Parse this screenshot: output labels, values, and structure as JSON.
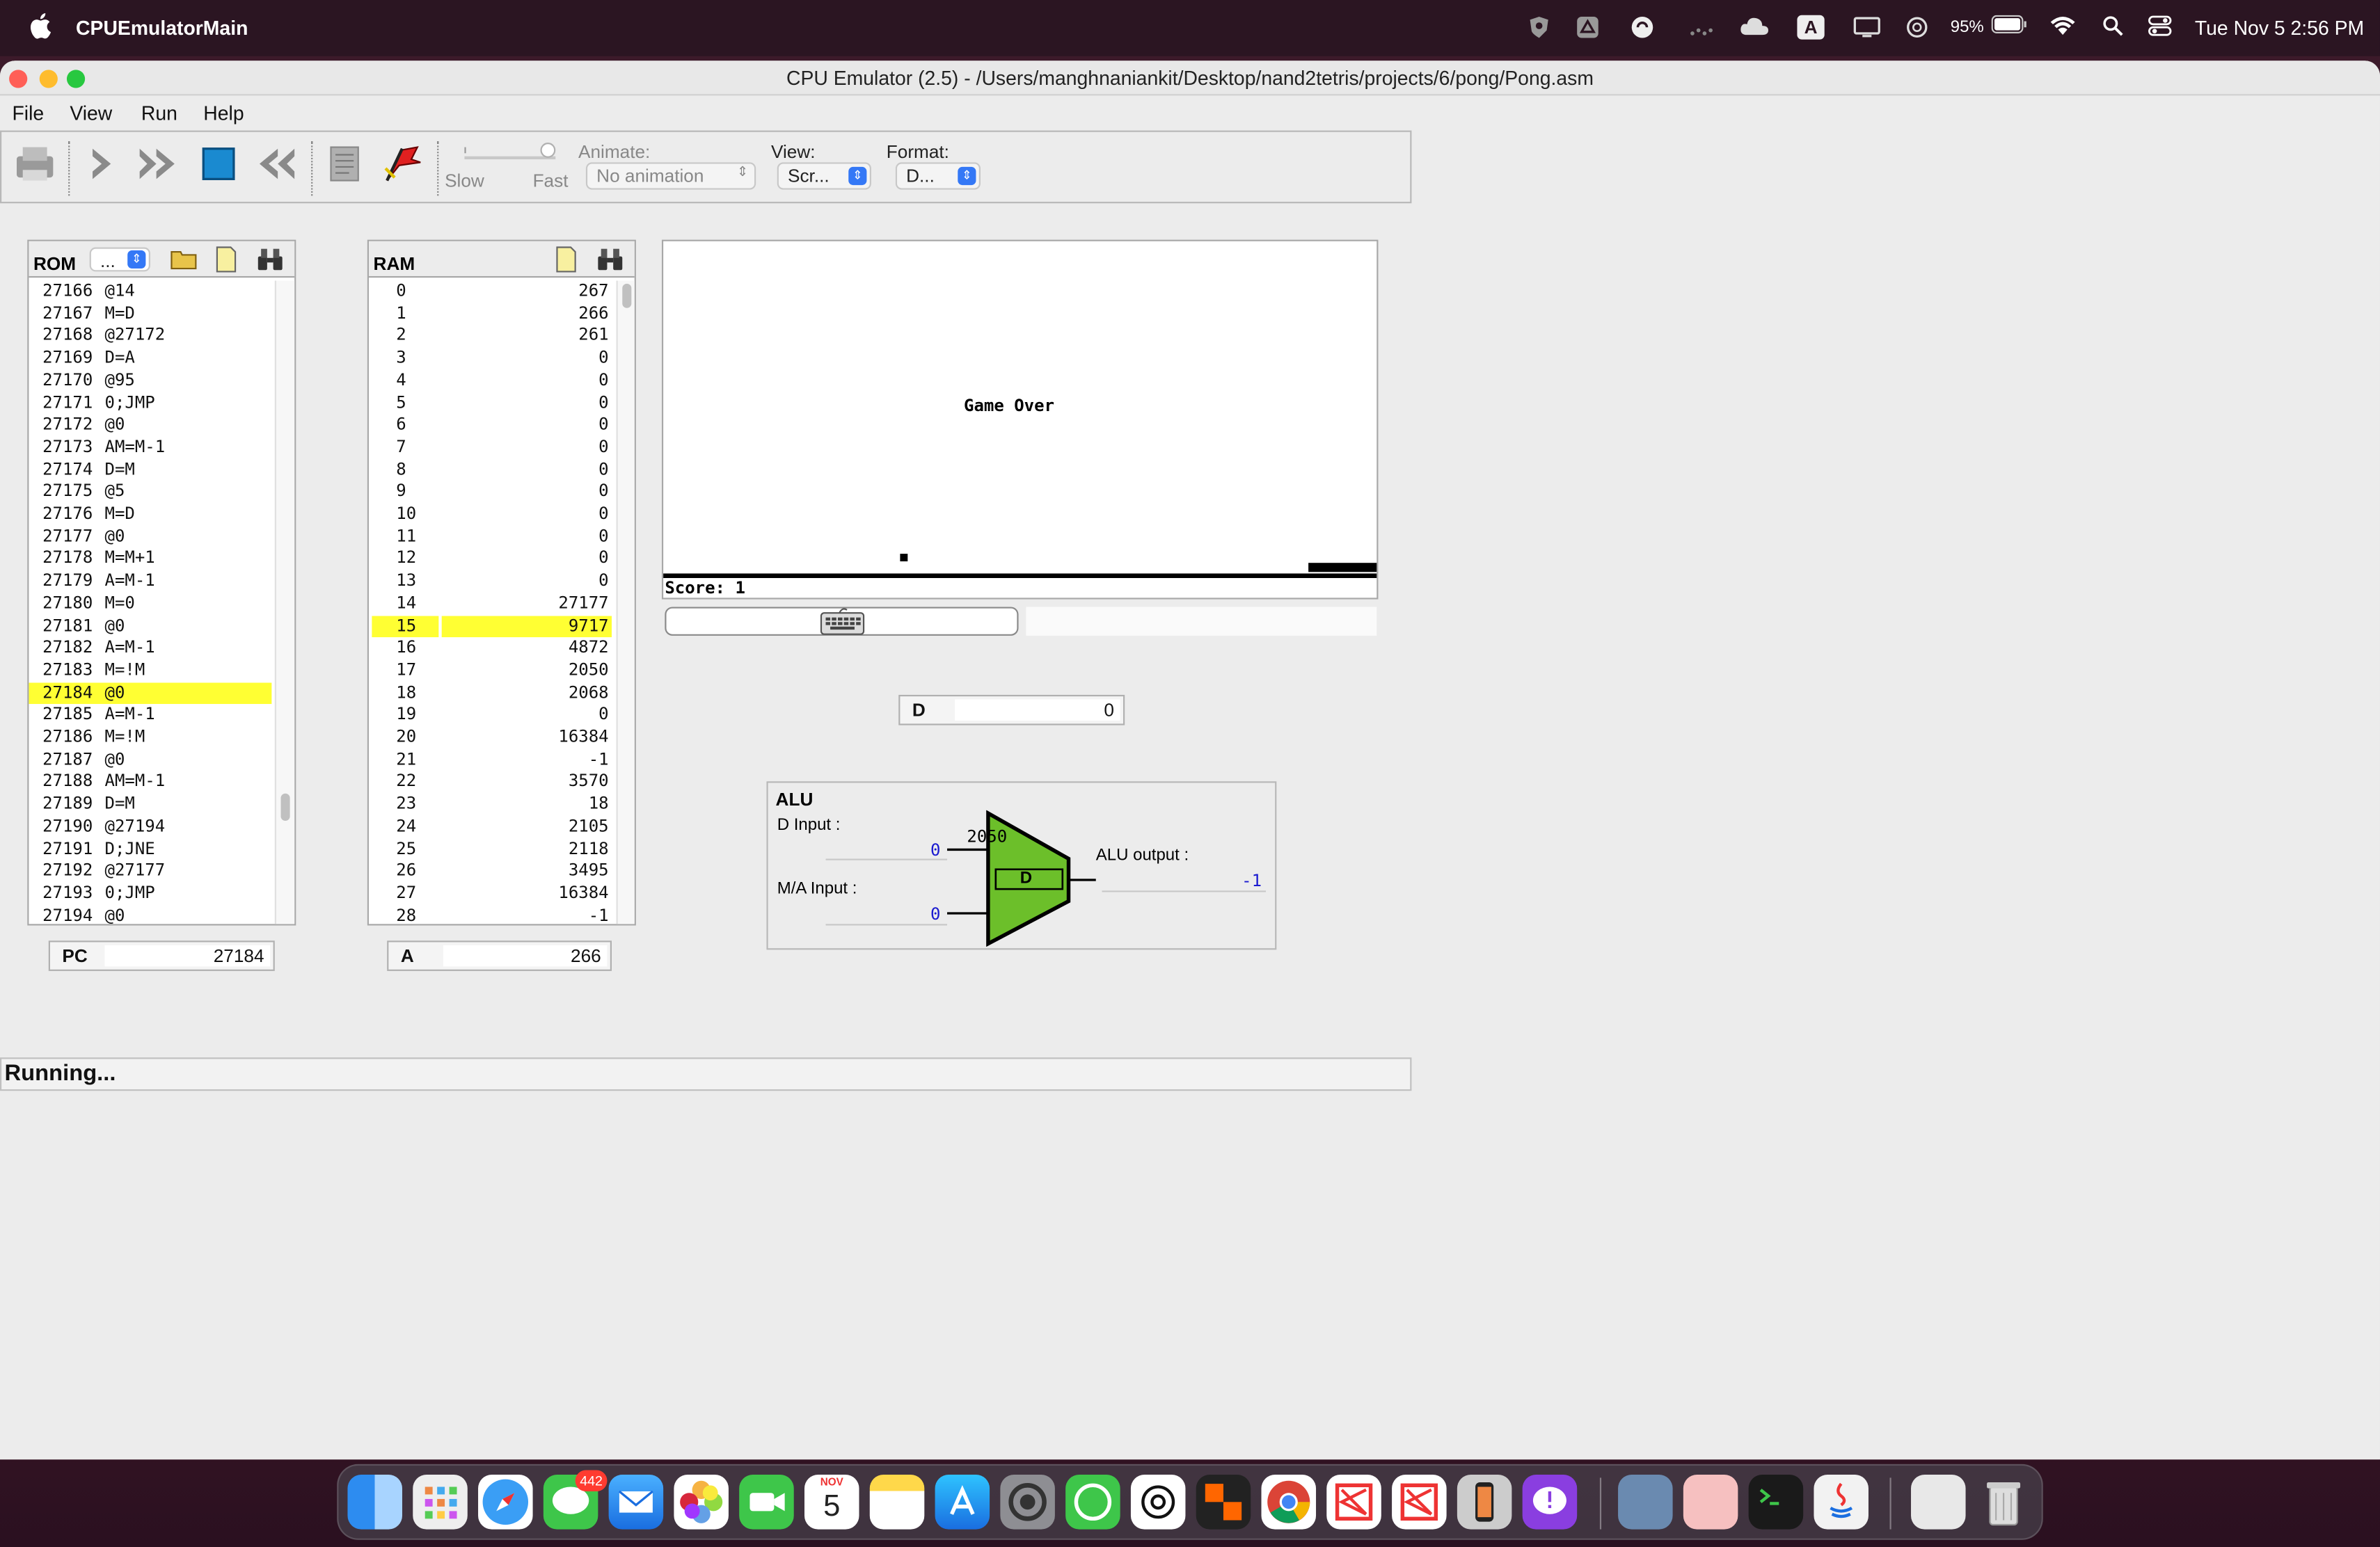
{
  "menubar": {
    "app_name": "CPUEmulatorMain",
    "battery": "95%",
    "clock": "Tue Nov 5  2:56 PM",
    "input_letter": "A"
  },
  "window": {
    "title": "CPU Emulator (2.5) - /Users/manghnaniankit/Desktop/nand2tetris/projects/6/pong/Pong.asm"
  },
  "menu": {
    "file": "File",
    "view": "View",
    "run": "Run",
    "help": "Help"
  },
  "toolbar": {
    "slow": "Slow",
    "fast": "Fast",
    "animate_label": "Animate:",
    "animate_value": "No animation",
    "view_label": "View:",
    "view_value": "Scr...",
    "format_label": "Format:",
    "format_value": "D..."
  },
  "rom": {
    "title": "ROM",
    "combo_value": "...",
    "rows": [
      {
        "addr": "27166",
        "instr": "@14"
      },
      {
        "addr": "27167",
        "instr": "M=D"
      },
      {
        "addr": "27168",
        "instr": "@27172"
      },
      {
        "addr": "27169",
        "instr": "D=A"
      },
      {
        "addr": "27170",
        "instr": "@95"
      },
      {
        "addr": "27171",
        "instr": "0;JMP"
      },
      {
        "addr": "27172",
        "instr": "@0"
      },
      {
        "addr": "27173",
        "instr": "AM=M-1"
      },
      {
        "addr": "27174",
        "instr": "D=M"
      },
      {
        "addr": "27175",
        "instr": "@5"
      },
      {
        "addr": "27176",
        "instr": "M=D"
      },
      {
        "addr": "27177",
        "instr": "@0"
      },
      {
        "addr": "27178",
        "instr": "M=M+1"
      },
      {
        "addr": "27179",
        "instr": "A=M-1"
      },
      {
        "addr": "27180",
        "instr": "M=0"
      },
      {
        "addr": "27181",
        "instr": "@0"
      },
      {
        "addr": "27182",
        "instr": "A=M-1"
      },
      {
        "addr": "27183",
        "instr": "M=!M"
      },
      {
        "addr": "27184",
        "instr": "@0"
      },
      {
        "addr": "27185",
        "instr": "A=M-1"
      },
      {
        "addr": "27186",
        "instr": "M=!M"
      },
      {
        "addr": "27187",
        "instr": "@0"
      },
      {
        "addr": "27188",
        "instr": "AM=M-1"
      },
      {
        "addr": "27189",
        "instr": "D=M"
      },
      {
        "addr": "27190",
        "instr": "@27194"
      },
      {
        "addr": "27191",
        "instr": "D;JNE"
      },
      {
        "addr": "27192",
        "instr": "@27177"
      },
      {
        "addr": "27193",
        "instr": "0;JMP"
      },
      {
        "addr": "27194",
        "instr": "@0"
      }
    ],
    "highlight_index": 18
  },
  "ram": {
    "title": "RAM",
    "rows": [
      {
        "addr": "0",
        "val": "267"
      },
      {
        "addr": "1",
        "val": "266"
      },
      {
        "addr": "2",
        "val": "261"
      },
      {
        "addr": "3",
        "val": "0"
      },
      {
        "addr": "4",
        "val": "0"
      },
      {
        "addr": "5",
        "val": "0"
      },
      {
        "addr": "6",
        "val": "0"
      },
      {
        "addr": "7",
        "val": "0"
      },
      {
        "addr": "8",
        "val": "0"
      },
      {
        "addr": "9",
        "val": "0"
      },
      {
        "addr": "10",
        "val": "0"
      },
      {
        "addr": "11",
        "val": "0"
      },
      {
        "addr": "12",
        "val": "0"
      },
      {
        "addr": "13",
        "val": "0"
      },
      {
        "addr": "14",
        "val": "27177"
      },
      {
        "addr": "15",
        "val": "9717"
      },
      {
        "addr": "16",
        "val": "4872"
      },
      {
        "addr": "17",
        "val": "2050"
      },
      {
        "addr": "18",
        "val": "2068"
      },
      {
        "addr": "19",
        "val": "0"
      },
      {
        "addr": "20",
        "val": "16384"
      },
      {
        "addr": "21",
        "val": "-1"
      },
      {
        "addr": "22",
        "val": "3570"
      },
      {
        "addr": "23",
        "val": "18"
      },
      {
        "addr": "24",
        "val": "2105"
      },
      {
        "addr": "25",
        "val": "2118"
      },
      {
        "addr": "26",
        "val": "3495"
      },
      {
        "addr": "27",
        "val": "16384"
      },
      {
        "addr": "28",
        "val": "-1"
      }
    ],
    "highlight_index": 15
  },
  "registers": {
    "pc_label": "PC",
    "pc_value": "27184",
    "a_label": "A",
    "a_value": "266",
    "d_label": "D",
    "d_value": "0"
  },
  "screen": {
    "game_over": "Game Over",
    "score": "Score: 1"
  },
  "alu": {
    "title": "ALU",
    "d_input_label": "D Input :",
    "d_input_value": "0",
    "ma_input_label": "M/A Input :",
    "ma_input_value": "0",
    "output_label": "ALU output :",
    "output_value": "-1",
    "op_text": "2050",
    "box_label": "D"
  },
  "status": {
    "text": "Running..."
  },
  "dock": {
    "messages_badge": "442",
    "calendar_month": "NOV",
    "calendar_day": "5"
  },
  "colors": {
    "highlight": "#ffff33",
    "alu_green": "#6cbf2a",
    "accent_blue": "#3478f6"
  }
}
